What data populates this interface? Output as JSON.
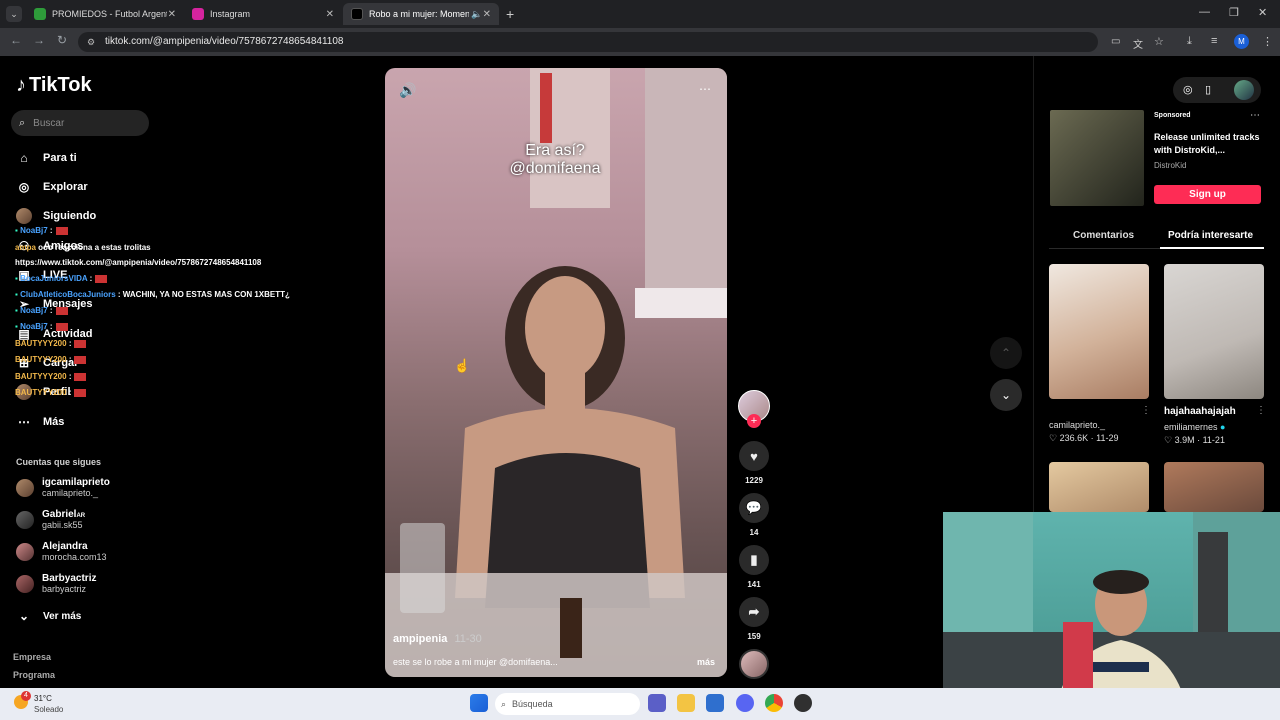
{
  "browser": {
    "tabs": [
      {
        "title": "PROMIEDOS - Futbol Argentino",
        "favicon_color": "#2e9b3a"
      },
      {
        "title": "Instagram",
        "favicon_color": "#d6249f"
      },
      {
        "title": "Robo a mi mujer: Momento",
        "favicon_color": "#000000"
      }
    ],
    "url": "tiktok.com/@ampipenia/video/7578672748654841108",
    "new_tab": "+"
  },
  "tiktok": {
    "logo": "TikTok",
    "search_placeholder": "Buscar",
    "nav": [
      {
        "label": "Para ti",
        "icon": "home-icon"
      },
      {
        "label": "Explorar",
        "icon": "compass-icon"
      },
      {
        "label": "Siguiendo",
        "icon": "following-icon"
      },
      {
        "label": "Amigos",
        "icon": "friends-icon"
      },
      {
        "label": "LIVE",
        "icon": "live-icon"
      },
      {
        "label": "Mensajes",
        "icon": "send-icon"
      },
      {
        "label": "Actividad",
        "icon": "activity-icon"
      },
      {
        "label": "Cargar",
        "icon": "upload-icon"
      },
      {
        "label": "Perfil",
        "icon": "profile-icon"
      },
      {
        "label": "Más",
        "icon": "more-icon"
      }
    ],
    "following_title": "Cuentas que sigues",
    "following": [
      {
        "name": "igcamilaprieto",
        "handle": "camilaprieto._"
      },
      {
        "name": "Gabriel",
        "badge": "AR",
        "handle": "gabii.sk55"
      },
      {
        "name": "Alejandra",
        "handle": "morocha.com13"
      },
      {
        "name": "Barbyactriz",
        "handle": "barbyactriz"
      }
    ],
    "see_more": "Ver más",
    "footer": [
      "Empresa",
      "Programa"
    ],
    "video": {
      "overlay_line1": "Era así?",
      "overlay_line2": "@domifaena",
      "author": "ampipenia",
      "date": "11-30",
      "caption": "este se lo robe a mi mujer @domifaena...",
      "more": "más"
    },
    "actions": {
      "likes": "1229",
      "comments": "14",
      "saves": "141",
      "shares": "159"
    },
    "sponsored": {
      "label": "Sponsored",
      "text": "Release unlimited tracks with DistroKid,...",
      "brand": "DistroKid",
      "cta": "Sign up"
    },
    "right_tabs": [
      "Comentarios",
      "Podría interesarte"
    ],
    "suggestions": [
      {
        "title": "camilaprieto._",
        "likes": "236.6K",
        "date": "11-29"
      },
      {
        "title": "hajahaahajajah",
        "author": "emiliamernes",
        "likes": "3.9M",
        "date": "11-21"
      }
    ]
  },
  "chat_overlay": [
    {
      "user": "NoaBj7",
      "text": ":",
      "flag": true,
      "style": "blue"
    },
    {
      "user": "ampa",
      "text": "ooo reacciona a estas trolitas",
      "style": "gold"
    },
    {
      "user": "",
      "text": "https://www.tiktok.com/@ampipenia/video/7578672748654841108",
      "style": "plain"
    },
    {
      "user": "BocaJuniorsVIDA",
      "text": ":",
      "flag": true,
      "style": "blue"
    },
    {
      "user": "ClubAtleticoBocaJuniors",
      "text": ": WACHIN, YA NO ESTAS MAS CON 1XBETT¿",
      "style": "blue"
    },
    {
      "user": "NoaBj7",
      "text": ":",
      "flag": true,
      "style": "blue"
    },
    {
      "user": "NoaBj7",
      "text": ":",
      "flag": true,
      "style": "blue"
    },
    {
      "user": "BAUTYYY200",
      "text": ":",
      "flag": true,
      "style": "gold"
    },
    {
      "user": "BAUTYYY200",
      "text": ":",
      "flag": true,
      "style": "gold"
    },
    {
      "user": "BAUTYYY200",
      "text": ":",
      "flag": true,
      "style": "gold"
    },
    {
      "user": "BAUTYYY200",
      "text": ":",
      "flag": true,
      "style": "gold"
    }
  ],
  "taskbar": {
    "temp": "31°C",
    "weather": "Soleado",
    "notif": "4",
    "search_placeholder": "Búsqueda"
  }
}
